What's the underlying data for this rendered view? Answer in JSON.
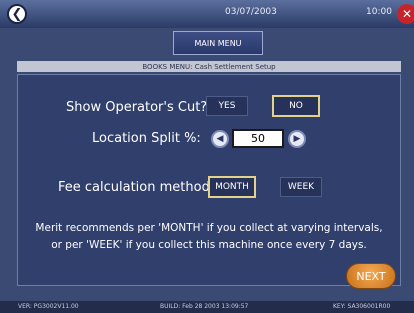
{
  "header": {
    "date": "03/07/2003",
    "time": "10:00",
    "main_menu_label": "MAIN MENU"
  },
  "breadcrumb": "BOOKS MENU: Cash Settlement Setup",
  "operator_cut": {
    "label": "Show Operator's Cut?",
    "yes_label": "YES",
    "no_label": "NO",
    "selected": "NO"
  },
  "location_split": {
    "label": "Location Split %:",
    "value": "50"
  },
  "fee_method": {
    "label": "Fee calculation method:",
    "month_label": "MONTH",
    "week_label": "WEEK",
    "selected": "MONTH"
  },
  "info": {
    "line1": "Merit recommends per 'MONTH' if you collect at varying intervals,",
    "line2": "or per 'WEEK' if you collect this machine once every 7 days."
  },
  "next_label": "NEXT",
  "footer": {
    "version": "VER: PG3002V11.00",
    "build": "BUILD: Feb 28 2003 13:09:57",
    "key": "KEY: SA306001R00"
  },
  "colors": {
    "background": "#3b4a72",
    "accent_next": "#e08a2c",
    "close": "#c8232b",
    "selected_border": "#e2d38a"
  },
  "icons": {
    "back": "chevron-left-icon",
    "close": "close-icon",
    "decrement": "arrow-left-icon",
    "increment": "arrow-right-icon"
  }
}
